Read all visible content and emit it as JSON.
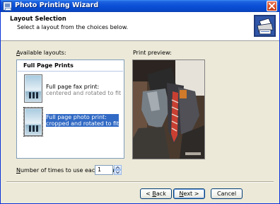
{
  "window": {
    "title": "Photo Printing Wizard"
  },
  "header": {
    "title": "Layout Selection",
    "subtitle": "Select a layout from the choices below."
  },
  "available_layouts": {
    "label_prefix": "A",
    "label_rest": "vailable layouts:",
    "group": "Full Page Prints",
    "items": [
      {
        "line1": "Full page fax print:",
        "line2": "centered and rotated to fit",
        "selected": false
      },
      {
        "line1": "Full page photo print:",
        "line2": "cropped and rotated to fit",
        "selected": true
      }
    ]
  },
  "preview": {
    "label": "Print preview:"
  },
  "copies": {
    "label_prefix": "N",
    "label_rest": "umber of times to use each picture:",
    "value": "1"
  },
  "buttons": {
    "back_key": "B",
    "back_rest": "ack",
    "back_prefix": "< ",
    "next_key": "N",
    "next_rest": "ext >",
    "cancel": "Cancel"
  },
  "icons": {
    "title": "printer-wizard-icon",
    "header": "printer-photo-icon",
    "close": "close-icon"
  },
  "colors": {
    "titlebar": "#0a4fd6",
    "selection": "#316ac5",
    "window": "#ece9d8"
  }
}
